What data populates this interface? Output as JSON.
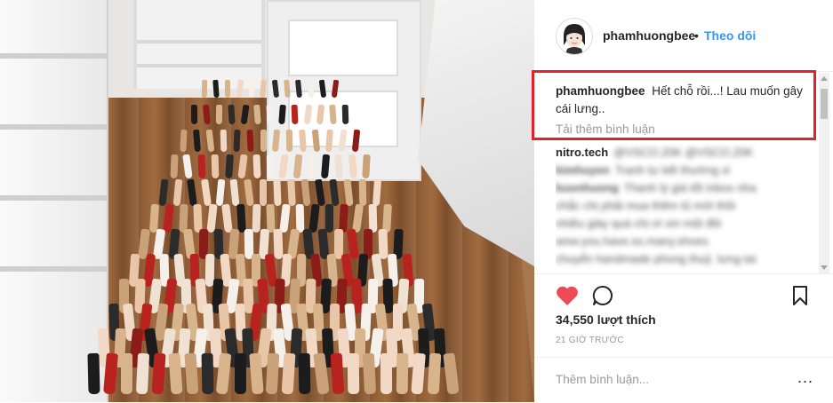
{
  "post": {
    "username": "phamhuongbee",
    "separator": "•",
    "follow_label": "Theo dõi",
    "caption_user": "phamhuongbee",
    "caption_text": "Hết chỗ rồi...! Lau muốn gây cái lưng..",
    "load_more_label": "Tải thêm bình luận",
    "comments": [
      {
        "user": "nitro.tech",
        "text": "@VSCO.20K @VSCO.20K"
      },
      {
        "user": "kimhuyen",
        "text": "Tranh tự kết thường xi"
      },
      {
        "user": "kuonhuong",
        "text": "Thanh lý giá tốt inbox nha"
      },
      {
        "user": "",
        "text": "chắc chị phải mua thêm tủ mới thôi"
      },
      {
        "user": "",
        "text": "nhiều giày quá chị ơi xin một đôi"
      },
      {
        "user": "",
        "text": "wow.you.have.so.many.shoes"
      },
      {
        "user": "",
        "text": "chuyển handmade phong thuỷ. lưng tai"
      }
    ],
    "likes_label": "34,550 lượt thích",
    "time_label": "21 GIỜ TRƯỚC",
    "add_comment_placeholder": "Thêm bình luận...",
    "more_label": "..."
  },
  "icons": {
    "like": "heart-icon",
    "comment": "comment-bubble-icon",
    "save": "bookmark-icon",
    "more": "more-options-icon"
  },
  "colors": {
    "like": "#ed4956",
    "follow": "#3897f0",
    "highlight": "#e0222a",
    "muted": "#999999"
  }
}
